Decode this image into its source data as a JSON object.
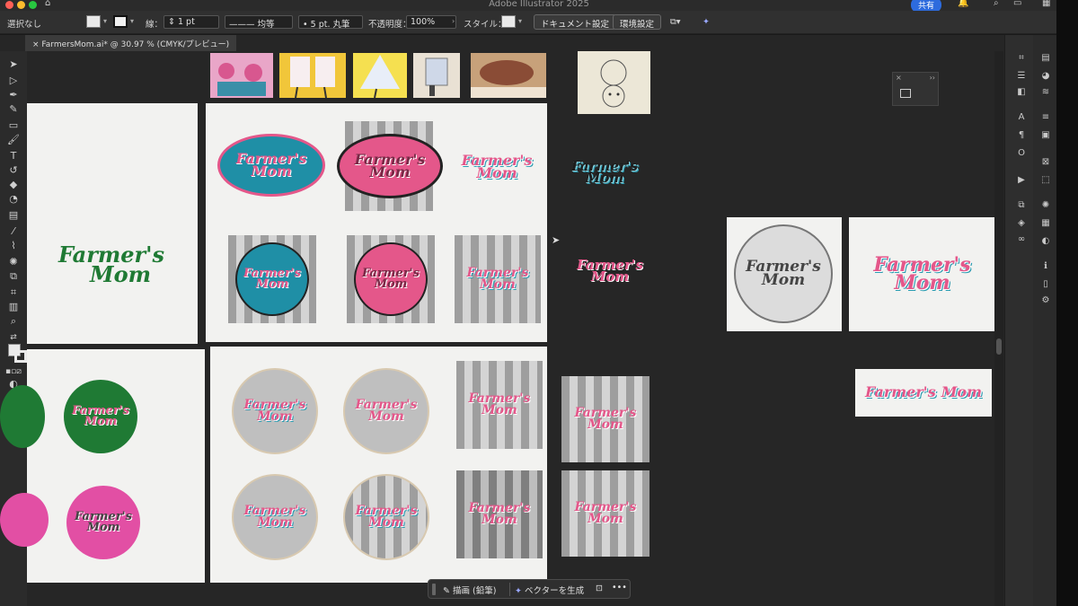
{
  "window": {
    "app_title": "Adobe Illustrator 2025",
    "share_label": "共有"
  },
  "controlbar": {
    "selection_status": "選択なし",
    "stroke_label": "線：",
    "stroke_value": "1 pt",
    "stroke_style": "均等",
    "brush_value": "5 pt. 丸筆",
    "opacity_label": "不透明度：",
    "opacity_value": "100%",
    "style_label": "スタイル：",
    "doc_settings_label": "ドキュメント設定",
    "preferences_label": "環境設定"
  },
  "document_tab": {
    "title": "FarmersMom.ai* @ 30.97 % (CMYK/プレビュー)"
  },
  "logo": {
    "line1": "Farmer's",
    "line2": "Mom"
  },
  "bottom_bar": {
    "draw_label": "描画 (鉛筆)",
    "vectorize_label": "ベクターを生成",
    "more": "•••"
  },
  "colors": {
    "teal": "#1f8fa6",
    "pink": "#e4578a",
    "green": "#1f7a34",
    "gray": "#bfbfbf",
    "share_blue": "#2d6bdd"
  }
}
